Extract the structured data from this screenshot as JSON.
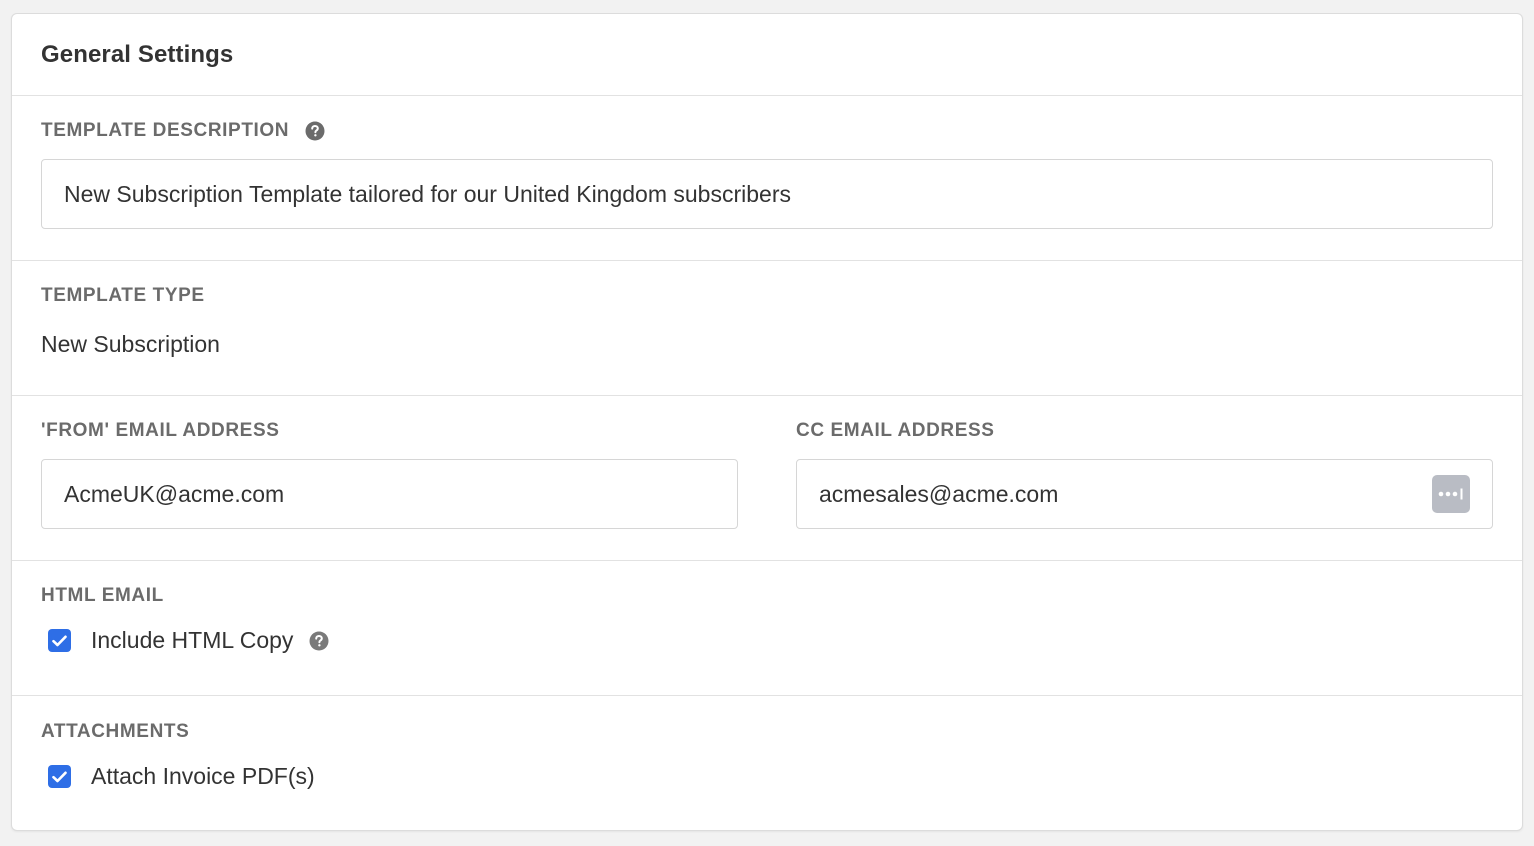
{
  "panel": {
    "title": "General Settings"
  },
  "template_description": {
    "label": "TEMPLATE DESCRIPTION",
    "value": "New Subscription Template tailored for our United Kingdom subscribers",
    "help_icon": "question-circle-icon"
  },
  "template_type": {
    "label": "TEMPLATE TYPE",
    "value": "New Subscription"
  },
  "from_email": {
    "label": "'FROM' EMAIL ADDRESS",
    "value": "AcmeUK@acme.com"
  },
  "cc_email": {
    "label": "CC EMAIL ADDRESS",
    "value": "acmesales@acme.com",
    "action_icon": "more-dots-icon"
  },
  "html_email": {
    "label": "HTML EMAIL",
    "checkbox_label": "Include HTML Copy",
    "checked": true,
    "help_icon": "question-circle-icon"
  },
  "attachments": {
    "label": "ATTACHMENTS",
    "checkbox_label": "Attach Invoice PDF(s)",
    "checked": true
  },
  "colors": {
    "checkbox": "#2e6ee6",
    "label": "#6b6b6b",
    "background": "#f2f2f2"
  }
}
